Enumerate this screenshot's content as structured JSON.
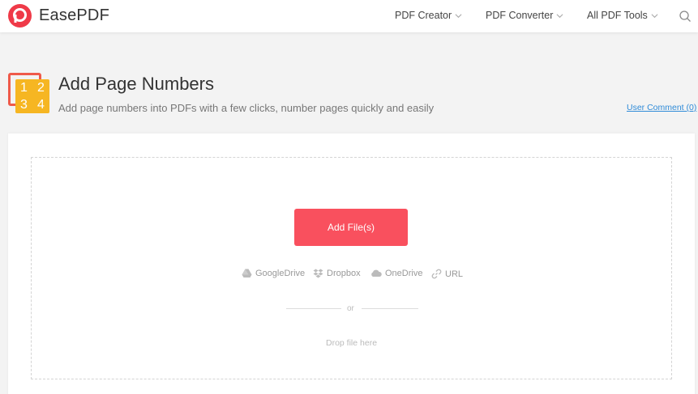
{
  "brand": {
    "name": "EasePDF",
    "accent": "#ef3a48"
  },
  "nav": {
    "pdf_creator": "PDF Creator",
    "pdf_converter": "PDF Converter",
    "all_tools": "All PDF Tools"
  },
  "tool": {
    "title": "Add Page Numbers",
    "subtitle": "Add page numbers into PDFs with a few clicks, number pages quickly and easily",
    "icon_digits": [
      "1",
      "2",
      "3",
      "4"
    ],
    "user_comment": "User Comment (0)"
  },
  "upload": {
    "add_button": "Add File(s)",
    "button_color": "#f9505e",
    "sources": {
      "google_drive": "GoogleDrive",
      "dropbox": "Dropbox",
      "onedrive": "OneDrive",
      "url": "URL"
    },
    "or": "or",
    "drop_hint": "Drop file here"
  }
}
